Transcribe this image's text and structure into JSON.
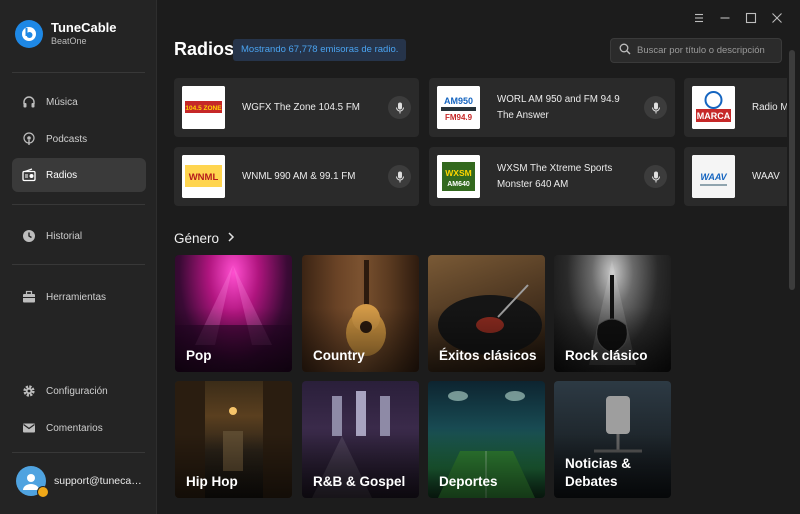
{
  "app": {
    "name": "TuneCable",
    "subtitle": "BeatOne"
  },
  "sidebar": {
    "items": [
      {
        "label": "Música",
        "icon": "headphones-icon"
      },
      {
        "label": "Podcasts",
        "icon": "podcast-icon"
      },
      {
        "label": "Radios",
        "icon": "radio-icon",
        "active": true
      },
      {
        "label": "Historial",
        "icon": "clock-icon"
      },
      {
        "label": "Herramientas",
        "icon": "toolbox-icon"
      },
      {
        "label": "Configuración",
        "icon": "gear-icon"
      },
      {
        "label": "Comentarios",
        "icon": "mail-icon"
      }
    ],
    "user_email": "support@tunecable.com"
  },
  "header": {
    "title": "Radios",
    "count_text": "Mostrando 67,778 emisoras de radio.",
    "search_placeholder": "Buscar por título o descripción"
  },
  "radios": [
    {
      "name": "WGFX The Zone 104.5 FM",
      "logo_text": "104.5 THE ZONE"
    },
    {
      "name": "WORL AM 950 and FM 94.9 The Answer",
      "logo_text": "AM950 FM94.9"
    },
    {
      "name": "Radio Marca",
      "logo_text": "RADIO MARCA"
    },
    {
      "name": "WNML 990 AM & 99.1 FM",
      "logo_text": "WNML"
    },
    {
      "name": "WXSM The Xtreme Sports Monster 640 AM",
      "logo_text": "WXSM AM640"
    },
    {
      "name": "WAAV",
      "logo_text": "WAAV"
    }
  ],
  "genres_title": "Género",
  "genres": [
    {
      "label": "Pop",
      "bg": "pop"
    },
    {
      "label": "Country",
      "bg": "country"
    },
    {
      "label": "Éxitos clásicos",
      "bg": "classics"
    },
    {
      "label": "Rock clásico",
      "bg": "rock"
    },
    {
      "label": "Hip Hop",
      "bg": "hiphop"
    },
    {
      "label": "R&B & Gospel",
      "bg": "gospel"
    },
    {
      "label": "Deportes",
      "bg": "sports"
    },
    {
      "label": "Noticias & Debates",
      "bg": "news"
    }
  ],
  "colors": {
    "accent": "#1e88e5",
    "pill_text": "#4aa3f0",
    "sidebar_bg": "#242424",
    "main_bg": "#1c1c1c"
  }
}
